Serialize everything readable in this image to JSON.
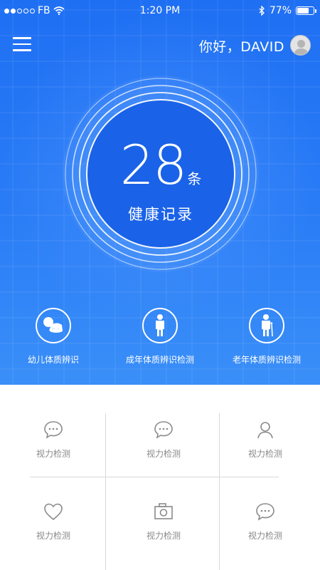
{
  "status_bar": {
    "carrier": "FB",
    "time": "1:20 PM",
    "battery_text": "77%",
    "battery_level": 0.77
  },
  "header": {
    "greeting": "你好，DAVID"
  },
  "summary": {
    "count": "28",
    "unit": "条",
    "label": "健康记录"
  },
  "categories": [
    {
      "label": "幼儿体质辨识",
      "icon": "baby-icon"
    },
    {
      "label": "成年体质辨识检测",
      "icon": "adult-icon"
    },
    {
      "label": "老年体质辨识检测",
      "icon": "elder-icon"
    }
  ],
  "tools": [
    {
      "label": "视力检测",
      "icon": "chat-bubble-icon"
    },
    {
      "label": "视力检测",
      "icon": "chat-bubble-icon"
    },
    {
      "label": "视力检测",
      "icon": "user-icon"
    },
    {
      "label": "视力检测",
      "icon": "heart-icon"
    },
    {
      "label": "视力检测",
      "icon": "camera-icon"
    },
    {
      "label": "视力检测",
      "icon": "chat-bubble-icon"
    }
  ],
  "colors": {
    "hero_blue": "#2a7cf6",
    "tool_icon_gray": "#8a8a8a"
  }
}
